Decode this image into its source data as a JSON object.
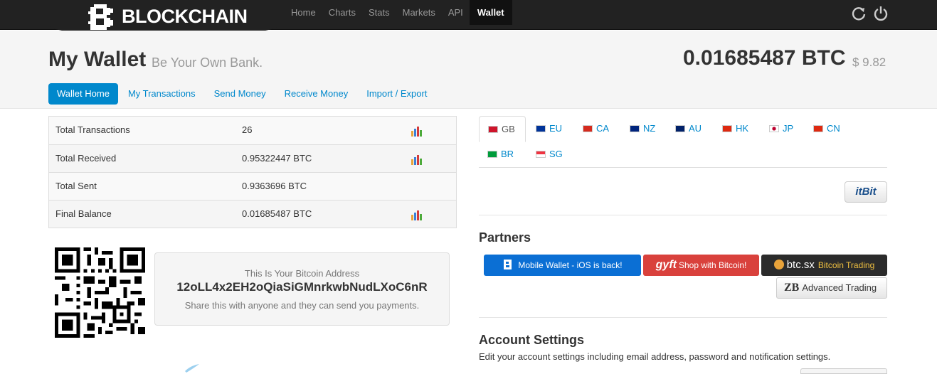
{
  "topbar": {
    "logo_text": "BLOCKCHAIN",
    "nav": [
      "Home",
      "Charts",
      "Stats",
      "Markets",
      "API",
      "Wallet"
    ],
    "active_nav": "Wallet",
    "icons": [
      "refresh-icon",
      "power-icon"
    ]
  },
  "header": {
    "title": "My Wallet",
    "subtitle": "Be Your Own Bank.",
    "balance_btc": "0.01685487 BTC",
    "balance_fiat": "$ 9.82",
    "tabs": [
      "Wallet Home",
      "My Transactions",
      "Send Money",
      "Receive Money",
      "Import / Export"
    ],
    "active_tab": "Wallet Home"
  },
  "stats": [
    {
      "label": "Total Transactions",
      "value": "26",
      "chart": true
    },
    {
      "label": "Total Received",
      "value": "0.95322447 BTC",
      "chart": true
    },
    {
      "label": "Total Sent",
      "value": "0.9363696 BTC",
      "chart": false
    },
    {
      "label": "Final Balance",
      "value": "0.01685487 BTC",
      "chart": true
    }
  ],
  "address": {
    "label": "This Is Your Bitcoin Address",
    "value": "12oLL4x2EH2oQiaSiGMnrkwbNudLXoC6nR",
    "hint": "Share this with anyone and they can send you payments."
  },
  "currencies": [
    "GB",
    "EU",
    "CA",
    "NZ",
    "AU",
    "HK",
    "JP",
    "CN",
    "BR",
    "SG"
  ],
  "active_currency": "GB",
  "exchange_button": "itBit",
  "partners": {
    "heading": "Partners",
    "buttons": [
      {
        "label": "Mobile Wallet - iOS is back!",
        "color": "#0b6fd4"
      },
      {
        "label": "Shop with Bitcoin!",
        "brand": "gyft",
        "color": "#d9413c"
      },
      {
        "label": "Bitcoin Trading",
        "brand": "btc.sx",
        "color": "#2b2b2b"
      }
    ],
    "advanced": {
      "brand": "ZB",
      "label": "Advanced Trading"
    }
  },
  "account": {
    "heading": "Account Settings",
    "description": "Edit your account settings including email address, password and notification settings."
  },
  "colors": {
    "accent": "#0088cc",
    "topbar": "#222222"
  }
}
